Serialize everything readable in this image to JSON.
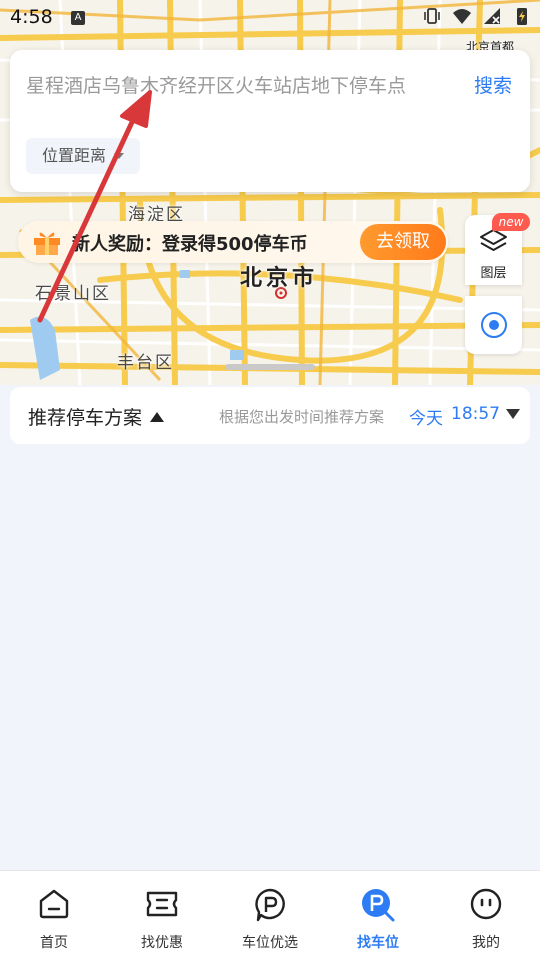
{
  "status_bar": {
    "time": "4:58",
    "notification_icon": "A"
  },
  "map": {
    "labels": {
      "haidian": "海淀区",
      "shijingshan": "石景山区",
      "beijing": "北京市",
      "fengtai": "丰台区",
      "airport": "北京首都"
    }
  },
  "search": {
    "placeholder": "星程酒店乌鲁木齐经开区火车站店地下停车点",
    "button_label": "搜索",
    "filter_label": "位置距离"
  },
  "promo": {
    "text": "新人奖励：登录得500停车币",
    "button_label": "去领取"
  },
  "map_controls": {
    "layer_label": "图层",
    "new_badge": "new"
  },
  "recommend": {
    "title": "推荐停车方案",
    "hint": "根据您出发时间推荐方案",
    "day": "今天",
    "time": "18:57"
  },
  "bottom_nav": {
    "items": [
      {
        "label": "首页",
        "icon": "home-icon"
      },
      {
        "label": "找优惠",
        "icon": "coupon-icon"
      },
      {
        "label": "车位优选",
        "icon": "parking-select-icon"
      },
      {
        "label": "找车位",
        "icon": "find-parking-icon"
      },
      {
        "label": "我的",
        "icon": "profile-icon"
      }
    ],
    "active_index": 3
  },
  "colors": {
    "accent": "#2d7cf4",
    "promo_button": "#ff8a24",
    "badge": "#ff5a4e",
    "road": "#f7c948",
    "annotation_arrow": "#d9383a"
  }
}
